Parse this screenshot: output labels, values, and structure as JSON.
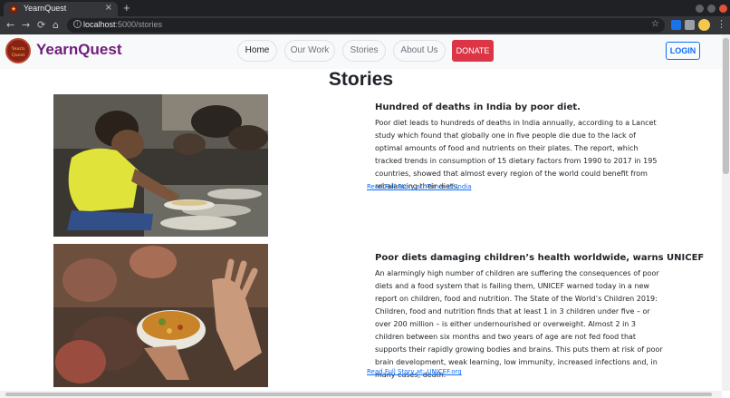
{
  "browser": {
    "tab_title": "YearnQuest",
    "tab_close": "×",
    "new_tab": "+",
    "url_host": "localhost",
    "url_path": ":5000/stories",
    "nav_back": "←",
    "nav_forward": "→",
    "nav_reload": "⟳",
    "nav_home": "⌂",
    "star": "☆",
    "menu": "⋮"
  },
  "site": {
    "brand": "YearnQuest",
    "logo_text": "Yearn Quest",
    "nav": [
      {
        "label": "Home",
        "active": true
      },
      {
        "label": "Our Work",
        "active": false
      },
      {
        "label": "Stories",
        "active": false
      },
      {
        "label": "About Us",
        "active": false
      }
    ],
    "donate_label": "DONATE",
    "login_label": "LOGIN"
  },
  "page": {
    "title": "Stories"
  },
  "stories": [
    {
      "title": "Hundred of deaths in India by poor diet.",
      "body": "Poor diet leads to hundreds of deaths in India annually, according to a Lancet study which found that globally one in five people die due to the lack of optimal amounts of food and nutrients on their plates. The report, which tracked trends in consumption of 15 dietary factors from 1990 to 2017 in 195 countries, showed that almost every region of the world could benefit from rebalancing their diets.",
      "link": "Read Full Story at: Times of India"
    },
    {
      "title": "Poor diets damaging children’s health worldwide, warns UNICEF",
      "body": "An alarmingly high number of children are suffering the consequences of poor diets and a food system that is failing them, UNICEF warned today in a new report on children, food and nutrition. The State of the World’s Children 2019: Children, food and nutrition finds that at least 1 in 3 children under five – or over 200 million – is either undernourished or overweight. Almost 2 in 3 children between six months and two years of age are not fed food that supports their rapidly growing bodies and brains. This puts them at risk of poor brain development, weak learning, low immunity, increased infections and, in many cases, death.",
      "link": "Read Full Story at: UNICEF.org"
    }
  ],
  "colors": {
    "brand": "#6f1d7a",
    "donate": "#dc3545",
    "link": "#0d6efd"
  }
}
